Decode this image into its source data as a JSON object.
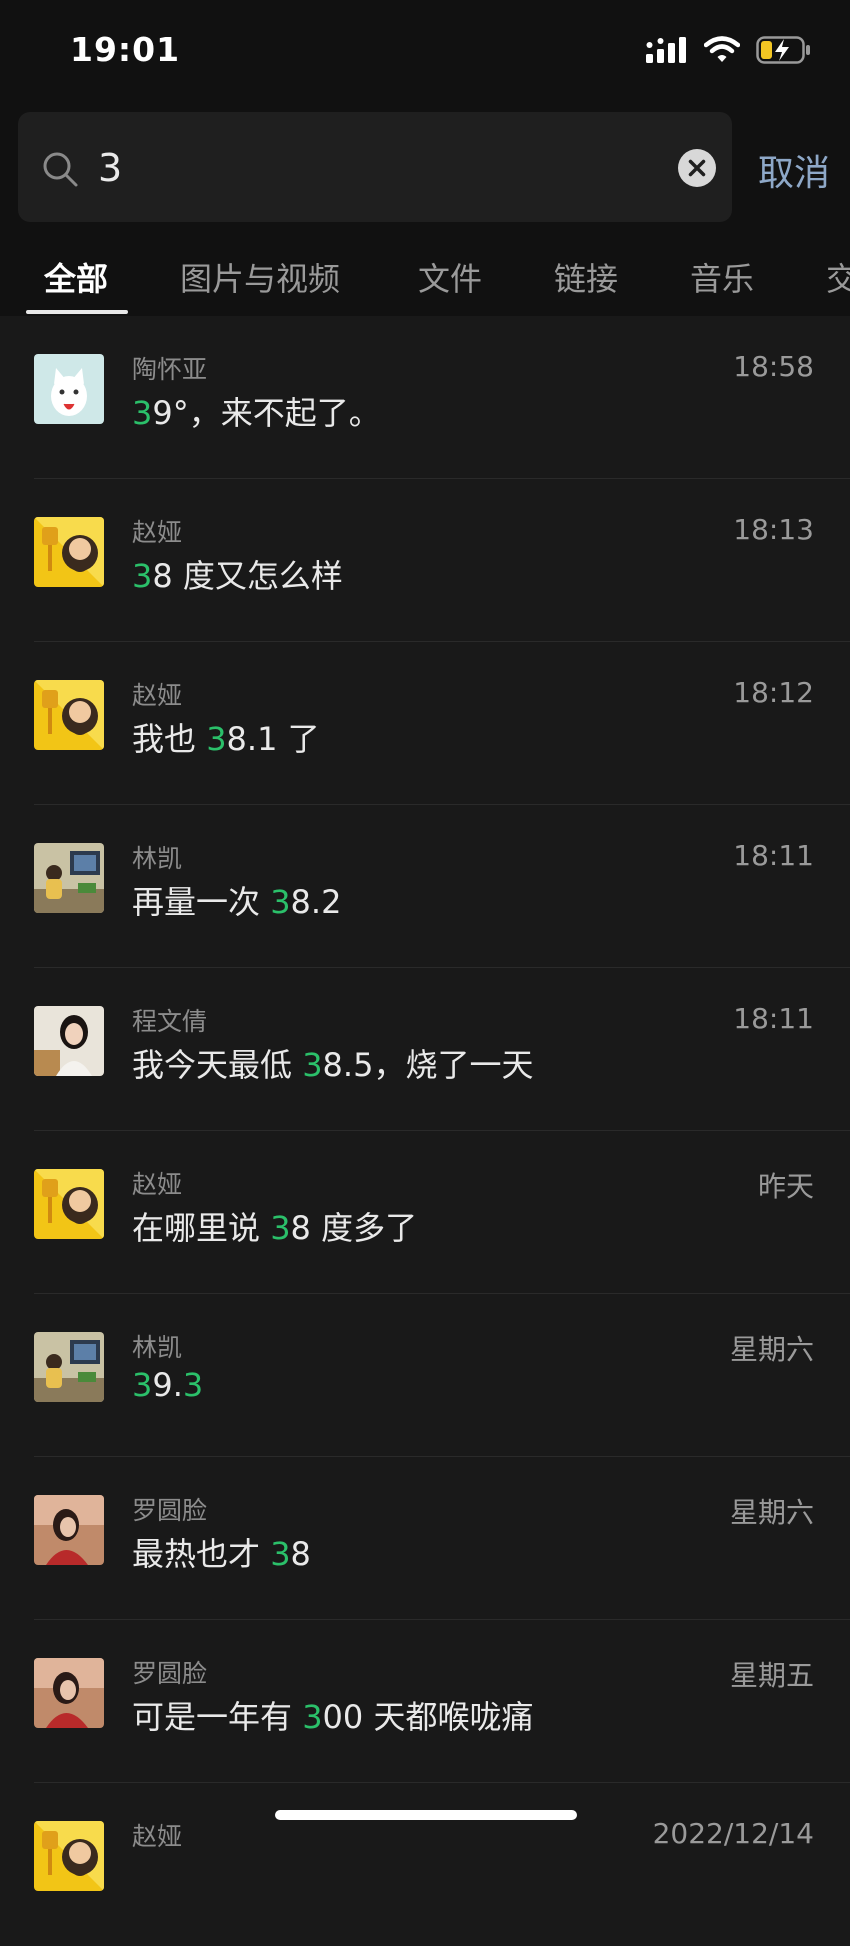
{
  "status": {
    "time": "19:01"
  },
  "search": {
    "value": "3",
    "cancel_label": "取消"
  },
  "tabs": [
    {
      "label": "全部",
      "active": true
    },
    {
      "label": "图片与视频"
    },
    {
      "label": "文件"
    },
    {
      "label": "链接"
    },
    {
      "label": "音乐"
    },
    {
      "label": "交"
    }
  ],
  "results": [
    {
      "name": "陶怀亚",
      "time": "18:58",
      "pre": "",
      "hit": "3",
      "post": "9°，来不起了。",
      "avatar": "cat-avatar"
    },
    {
      "name": "赵娅",
      "time": "18:13",
      "pre": "",
      "hit": "3",
      "post": "8 度又怎么样",
      "avatar": "cartoon-trophy-avatar"
    },
    {
      "name": "赵娅",
      "time": "18:12",
      "pre": "我也 ",
      "hit": "3",
      "post": "8.1 了",
      "avatar": "cartoon-trophy-avatar"
    },
    {
      "name": "林凯",
      "time": "18:11",
      "pre": "再量一次 ",
      "hit": "3",
      "post": "8.2",
      "avatar": "illustration-room-avatar"
    },
    {
      "name": "程文倩",
      "time": "18:11",
      "pre": "我今天最低 ",
      "hit": "3",
      "post": "8.5，烧了一天",
      "avatar": "portrait-girl-avatar"
    },
    {
      "name": "赵娅",
      "time": "昨天",
      "pre": "在哪里说 ",
      "hit": "3",
      "post": "8 度多了",
      "avatar": "cartoon-trophy-avatar"
    },
    {
      "name": "林凯",
      "time": "星期六",
      "pre": "",
      "hit": "3",
      "mid": "9.",
      "hit2": "3",
      "post": "",
      "avatar": "illustration-room-avatar"
    },
    {
      "name": "罗圆脸",
      "time": "星期六",
      "pre": "最热也才 ",
      "hit": "3",
      "post": "8",
      "avatar": "portrait-field-avatar"
    },
    {
      "name": "罗圆脸",
      "time": "星期五",
      "pre": "可是一年有 ",
      "hit": "3",
      "post": "00 天都喉咙痛",
      "avatar": "portrait-field-avatar"
    },
    {
      "name": "赵娅",
      "time": "2022/12/14",
      "pre": "",
      "hit": "",
      "post": "",
      "avatar": "cartoon-trophy-avatar"
    }
  ],
  "colors": {
    "highlight": "#2bc06a",
    "background": "#191919",
    "cancel": "#8ea8c8"
  }
}
